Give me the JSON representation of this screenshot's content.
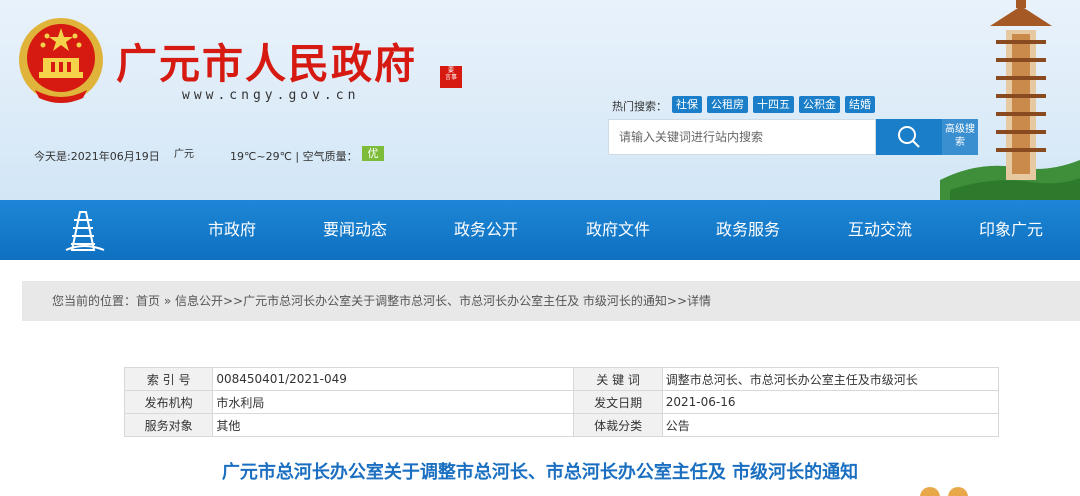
{
  "header": {
    "site_title": "广元市人民政府",
    "site_url": "www.cngy.gov.cn",
    "seal_text": "要言事",
    "date_text": "今天是:2021年06月19日",
    "city": "广元",
    "weather_text": "19℃~29℃ | 空气质量：",
    "air_quality": "优",
    "hot_search_label": "热门搜索：",
    "hot_tags": [
      "社保",
      "公租房",
      "十四五",
      "公积金",
      "结婚"
    ],
    "search_placeholder": "请输入关键词进行站内搜索",
    "advanced_search": "高级搜索"
  },
  "nav": {
    "items": [
      "市政府",
      "要闻动态",
      "政务公开",
      "政府文件",
      "政务服务",
      "互动交流",
      "印象广元"
    ]
  },
  "breadcrumb": "您当前的位置：首页 » 信息公开>>广元市总河长办公室关于调整市总河长、市总河长办公室主任及 市级河长的通知>>详情",
  "info": {
    "rows": [
      {
        "label1": "索 引 号",
        "value1": "008450401/2021-049",
        "label2": "关 键 词",
        "value2": "调整市总河长、市总河长办公室主任及市级河长"
      },
      {
        "label1": "发布机构",
        "value1": "市水利局",
        "label2": "发文日期",
        "value2": "2021-06-16"
      },
      {
        "label1": "服务对象",
        "value1": "其他",
        "label2": "体裁分类",
        "value2": "公告"
      }
    ]
  },
  "doc_title": "广元市总河长办公室关于调整市总河长、市总河长办公室主任及 市级河长的通知",
  "colors": {
    "brand_red": "#d61a12",
    "nav_blue": "#0f70c0",
    "title_blue": "#1a6fc0",
    "aqi_green": "#7cbc38"
  }
}
